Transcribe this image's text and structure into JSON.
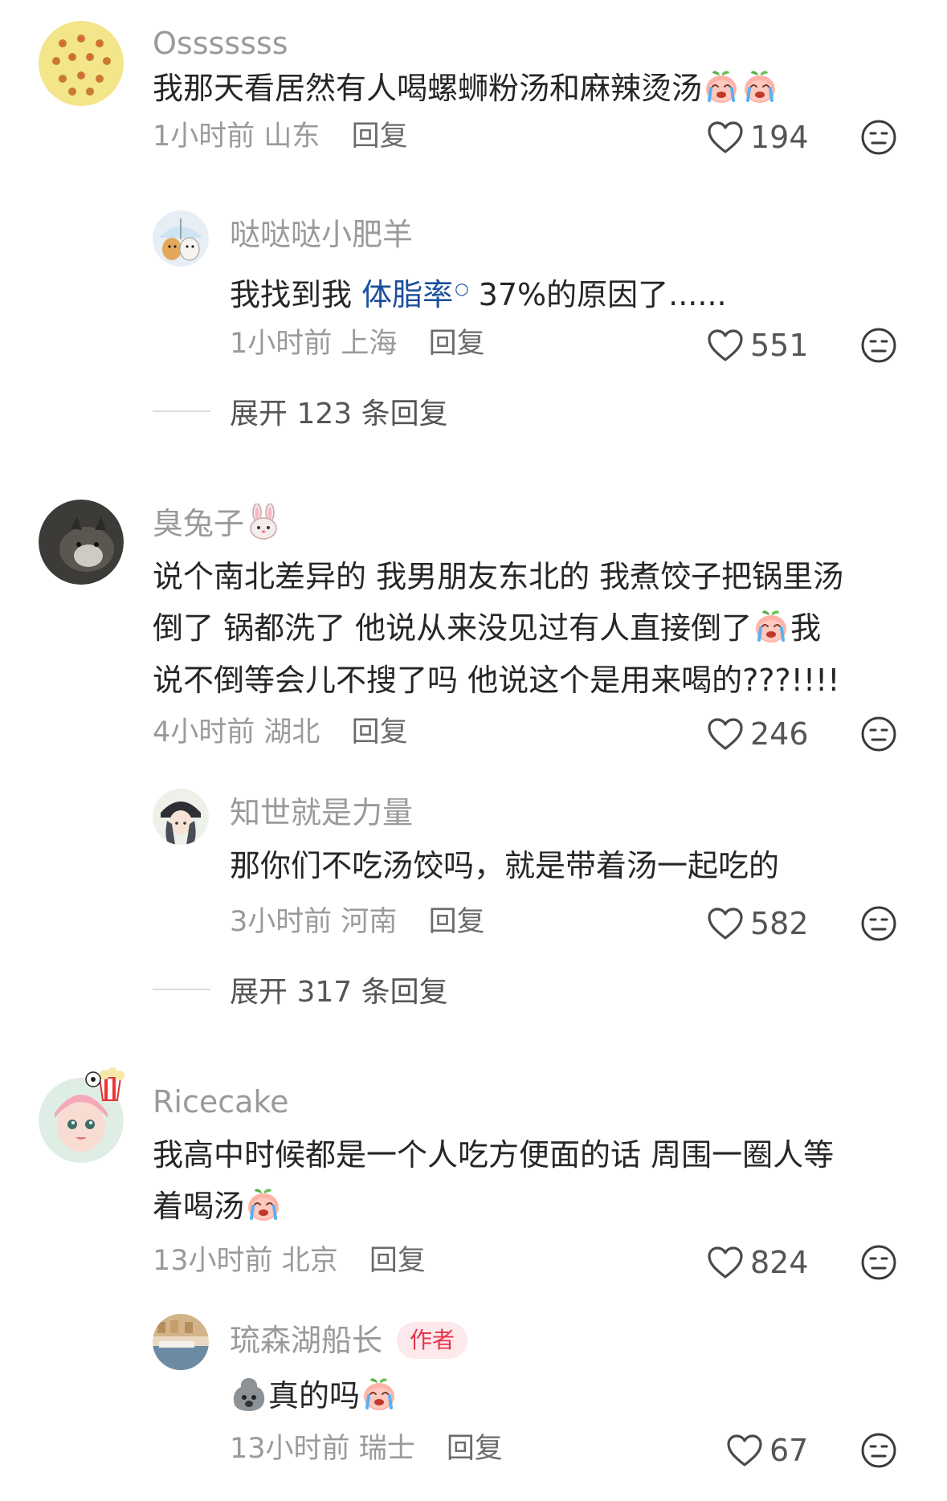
{
  "comments": [
    {
      "username": "Osssssss",
      "text": "我那天看居然有人喝螺蛳粉汤和麻辣烫汤",
      "time": "1小时前",
      "location": "山东",
      "reply": "回复",
      "likes": "194",
      "reply_item": {
        "username": "哒哒哒小肥羊",
        "text_before": "我找到我",
        "hashtag": "体脂率",
        "text_after": "37%的原因了......",
        "time": "1小时前",
        "location": "上海",
        "reply": "回复",
        "likes": "551"
      },
      "expand_label": "展开 123 条回复"
    },
    {
      "username": "臭兔子",
      "text_lines": [
        "说个南北差异的 我男朋友东北的 我煮饺子把锅里汤",
        "倒了 锅都洗了 他说从来没见过有人直接倒了",
        "说不倒等会儿不搜了吗 他说这个是用来喝的???!!!!"
      ],
      "text_line2_tail": "我",
      "time": "4小时前",
      "location": "湖北",
      "reply": "回复",
      "likes": "246",
      "reply_item": {
        "username": "知世就是力量",
        "text": "那你们不吃汤饺吗，就是带着汤一起吃的",
        "time": "3小时前",
        "location": "河南",
        "reply": "回复",
        "likes": "582"
      },
      "expand_label": "展开 317 条回复"
    },
    {
      "username": "Ricecake",
      "text_lines": [
        "我高中时候都是一个人吃方便面的话 周围一圈人等",
        "着喝汤"
      ],
      "time": "13小时前",
      "location": "北京",
      "reply": "回复",
      "likes": "824",
      "reply_item": {
        "username": "琉森湖船长",
        "badge": "作者",
        "text": "真的吗",
        "time": "13小时前",
        "location": "瑞士",
        "reply": "回复",
        "likes": "67"
      }
    }
  ],
  "icons": {
    "like": "heart-outline-icon",
    "dislike": "neutral-face-icon",
    "emoji": "crying-peach-emoji",
    "gray_emoji": "gray-blob-emoji",
    "rabbit": "rabbit-emoji"
  },
  "colors": {
    "name": "#9a9a9a",
    "text": "#262626",
    "hashtag": "#1b4f9c",
    "author_badge_bg": "#fde8ec",
    "author_badge_text": "#e5354b"
  }
}
